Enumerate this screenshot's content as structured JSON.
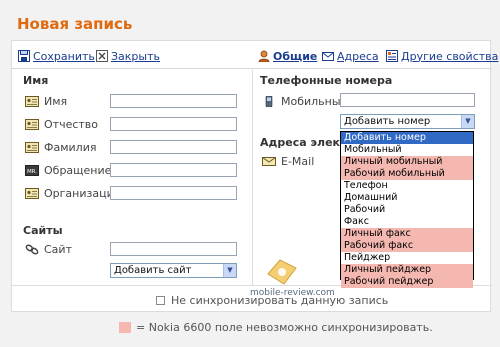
{
  "page": {
    "title": "Новая запись"
  },
  "toolbar": {
    "save_label": "Сохранить",
    "close_label": "Закрыть",
    "tabs": [
      {
        "label": "Общие",
        "icon": "person-icon",
        "active": true
      },
      {
        "label": "Адреса",
        "icon": "envelope-icon",
        "active": false
      },
      {
        "label": "Другие свойства",
        "icon": "properties-icon",
        "active": false
      }
    ]
  },
  "name_section": {
    "title": "Имя",
    "fields": [
      {
        "label": "Имя",
        "icon": "card-icon",
        "value": ""
      },
      {
        "label": "Отчество",
        "icon": "card-icon",
        "value": ""
      },
      {
        "label": "Фамилия",
        "icon": "card-icon",
        "value": ""
      },
      {
        "label": "Обращение",
        "icon": "title-badge-icon",
        "value": ""
      },
      {
        "label": "Организация",
        "icon": "card-icon",
        "value": ""
      }
    ],
    "title_badge_text": "MR."
  },
  "sites_section": {
    "title": "Сайты",
    "site_label": "Сайт",
    "site_value": "",
    "add_site_select": "Добавить сайт"
  },
  "phones_section": {
    "title": "Телефонные номера",
    "mobile_label": "Мобильный",
    "mobile_value": "",
    "add_number_select": "Добавить номер"
  },
  "email_section": {
    "title": "Адреса электр",
    "email_label": "E-Mail"
  },
  "dropdown_options": [
    {
      "label": "Добавить номер",
      "selected": true,
      "pink": false
    },
    {
      "label": "Мобильный",
      "selected": false,
      "pink": false
    },
    {
      "label": "Личный мобильный",
      "selected": false,
      "pink": true
    },
    {
      "label": "Рабочий мобильный",
      "selected": false,
      "pink": true
    },
    {
      "label": "Телефон",
      "selected": false,
      "pink": false
    },
    {
      "label": "Домашний",
      "selected": false,
      "pink": false
    },
    {
      "label": "Рабочий",
      "selected": false,
      "pink": false
    },
    {
      "label": "Факс",
      "selected": false,
      "pink": false
    },
    {
      "label": "Личный факс",
      "selected": false,
      "pink": true
    },
    {
      "label": "Рабочий факс",
      "selected": false,
      "pink": true
    },
    {
      "label": "Пейджер",
      "selected": false,
      "pink": false
    },
    {
      "label": "Личный пейджер",
      "selected": false,
      "pink": true
    },
    {
      "label": "Рабочий пейджер",
      "selected": false,
      "pink": true
    }
  ],
  "sync": {
    "checkbox_label": "Не синхронизировать данную запись",
    "checked": false
  },
  "legend": {
    "text": "= Nokia 6600 поле невозможно синхронизировать."
  },
  "watermark": {
    "text": "mobile-review.com"
  },
  "colors": {
    "title": "#e06a10",
    "link": "#1a3d8f",
    "pink_highlight": "#f5b8b0",
    "selection": "#316ac5"
  }
}
